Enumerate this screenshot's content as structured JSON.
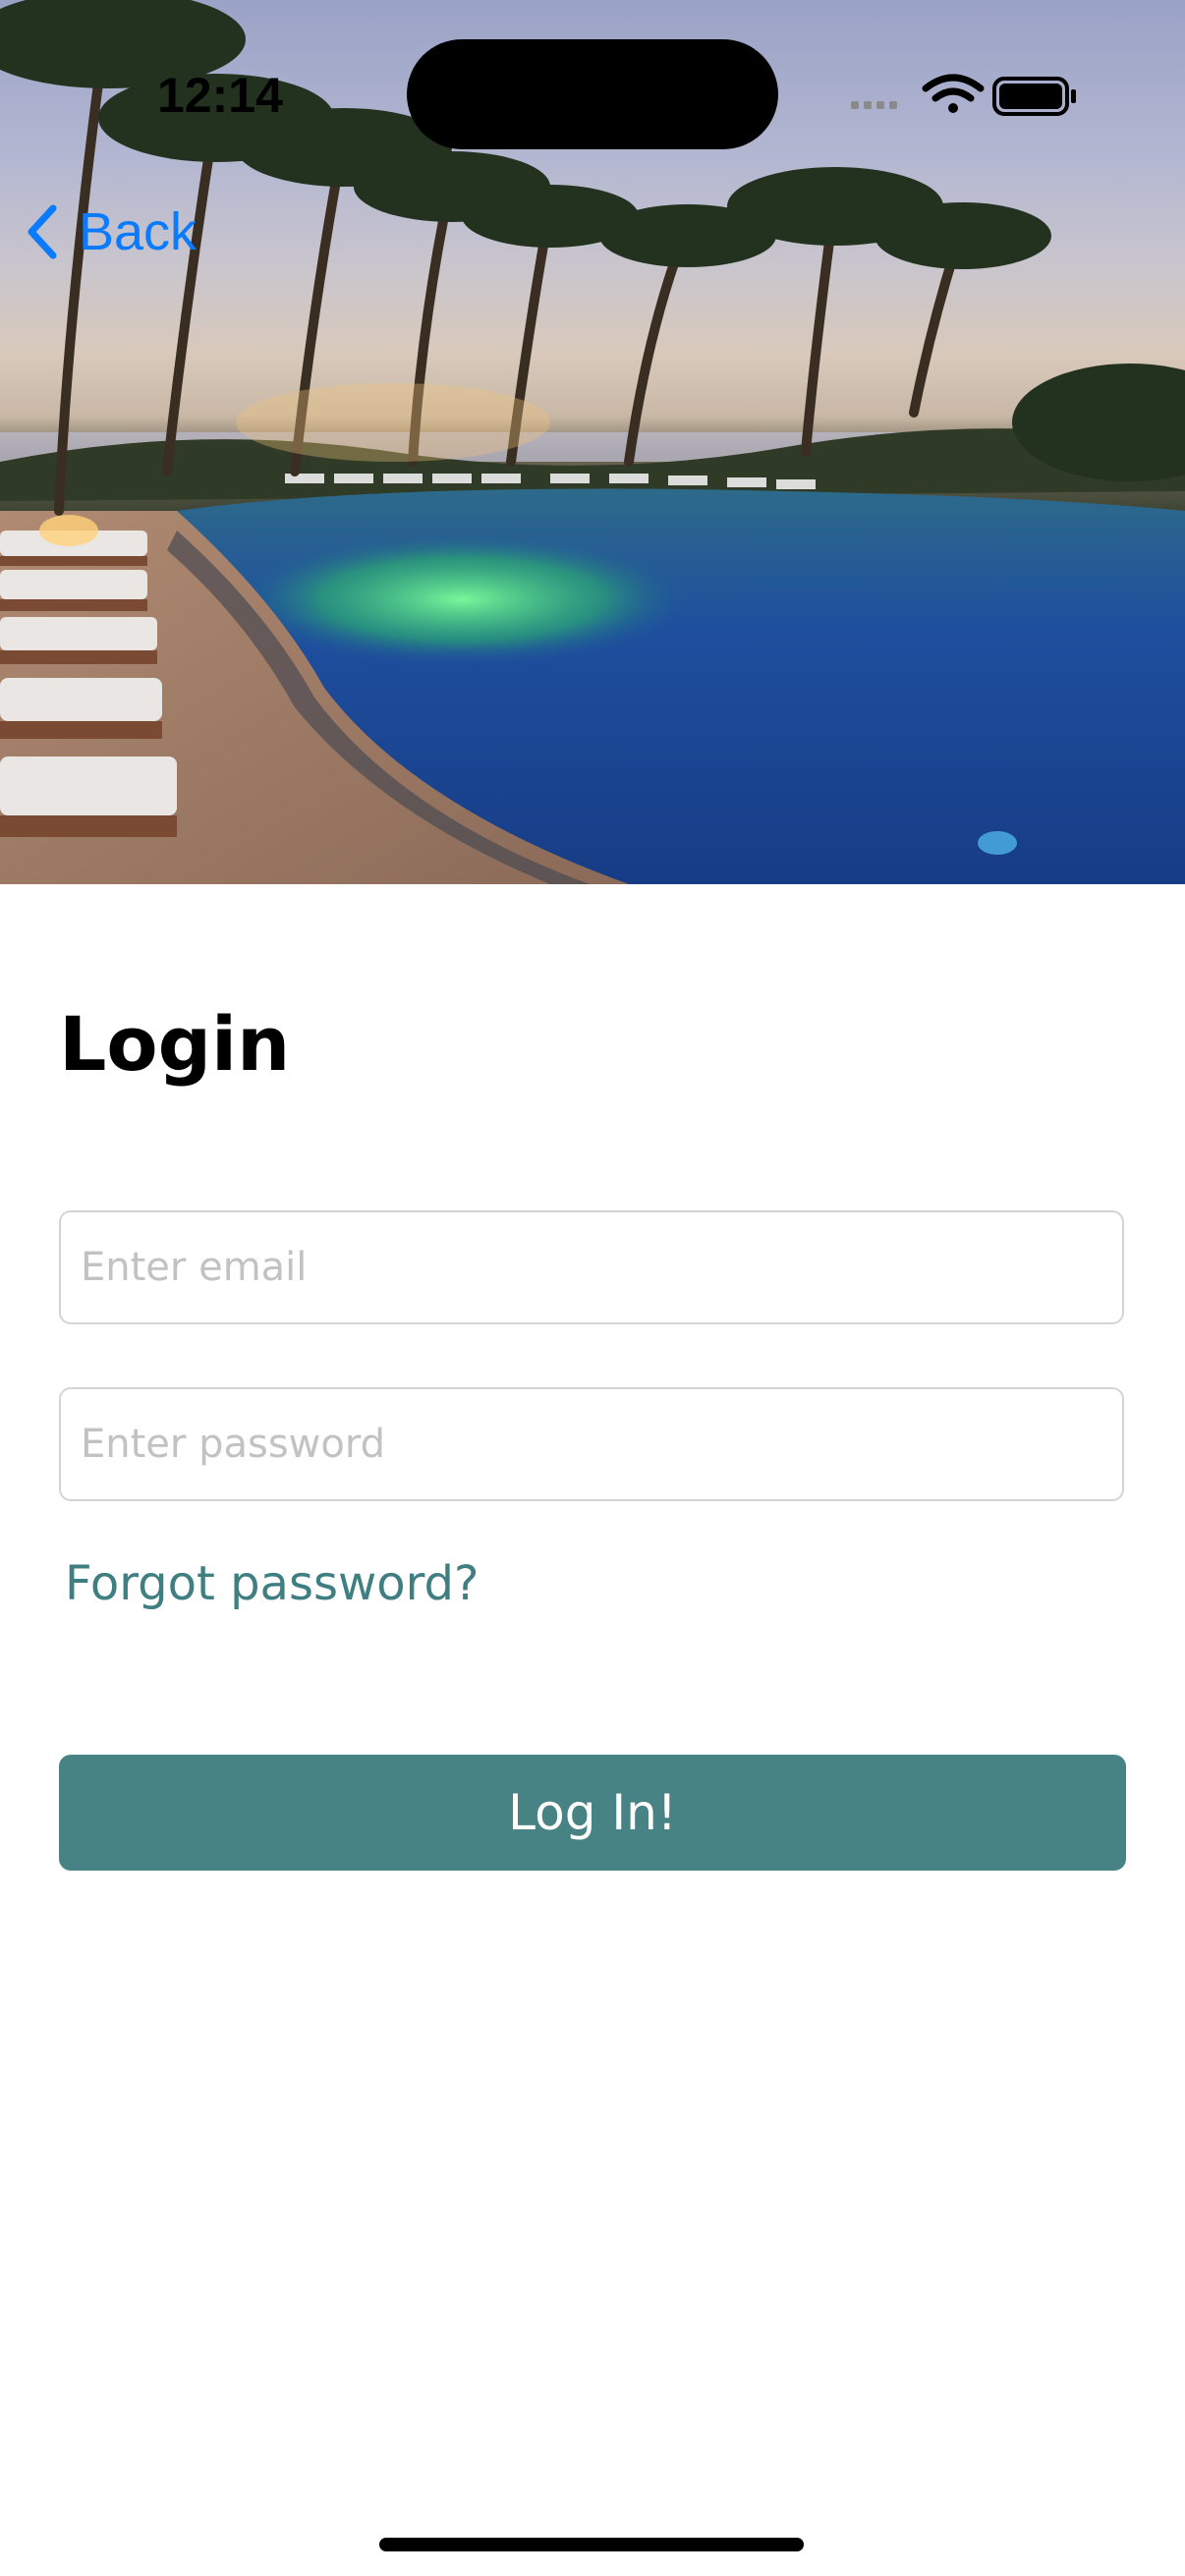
{
  "status_bar": {
    "time": "12:14"
  },
  "nav": {
    "back_label": "Back"
  },
  "hero": {
    "image": "resort-pool-palm-trees"
  },
  "login": {
    "title": "Login",
    "email_placeholder": "Enter email",
    "password_placeholder": "Enter password",
    "forgot_label": "Forgot password?",
    "submit_label": "Log In!"
  },
  "colors": {
    "accent": "#478285",
    "link": "#3f7f82",
    "back": "#0a7bff"
  }
}
